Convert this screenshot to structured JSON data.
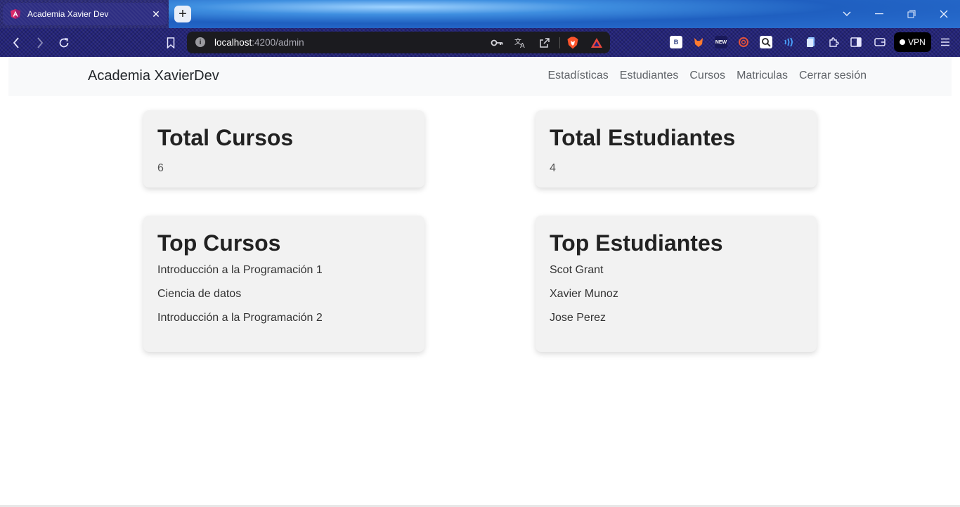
{
  "browser": {
    "tab_title": "Academia Xavier Dev",
    "url_host": "localhost",
    "url_path": ":4200/admin",
    "vpn_label": "VPN",
    "accent": "#23237a"
  },
  "navbar": {
    "brand": "Academia XavierDev",
    "links": [
      "Estadísticas",
      "Estudiantes",
      "Cursos",
      "Matriculas",
      "Cerrar sesión"
    ]
  },
  "stats": {
    "total_courses": {
      "title": "Total Cursos",
      "value": "6"
    },
    "total_students": {
      "title": "Total Estudiantes",
      "value": "4"
    }
  },
  "top_courses": {
    "title": "Top Cursos",
    "items": [
      "Introducción a la Programación 1",
      "Ciencia de datos",
      "Introducción a la Programación 2"
    ]
  },
  "top_students": {
    "title": "Top Estudiantes",
    "items": [
      "Scot Grant",
      "Xavier Munoz",
      "Jose Perez"
    ]
  }
}
